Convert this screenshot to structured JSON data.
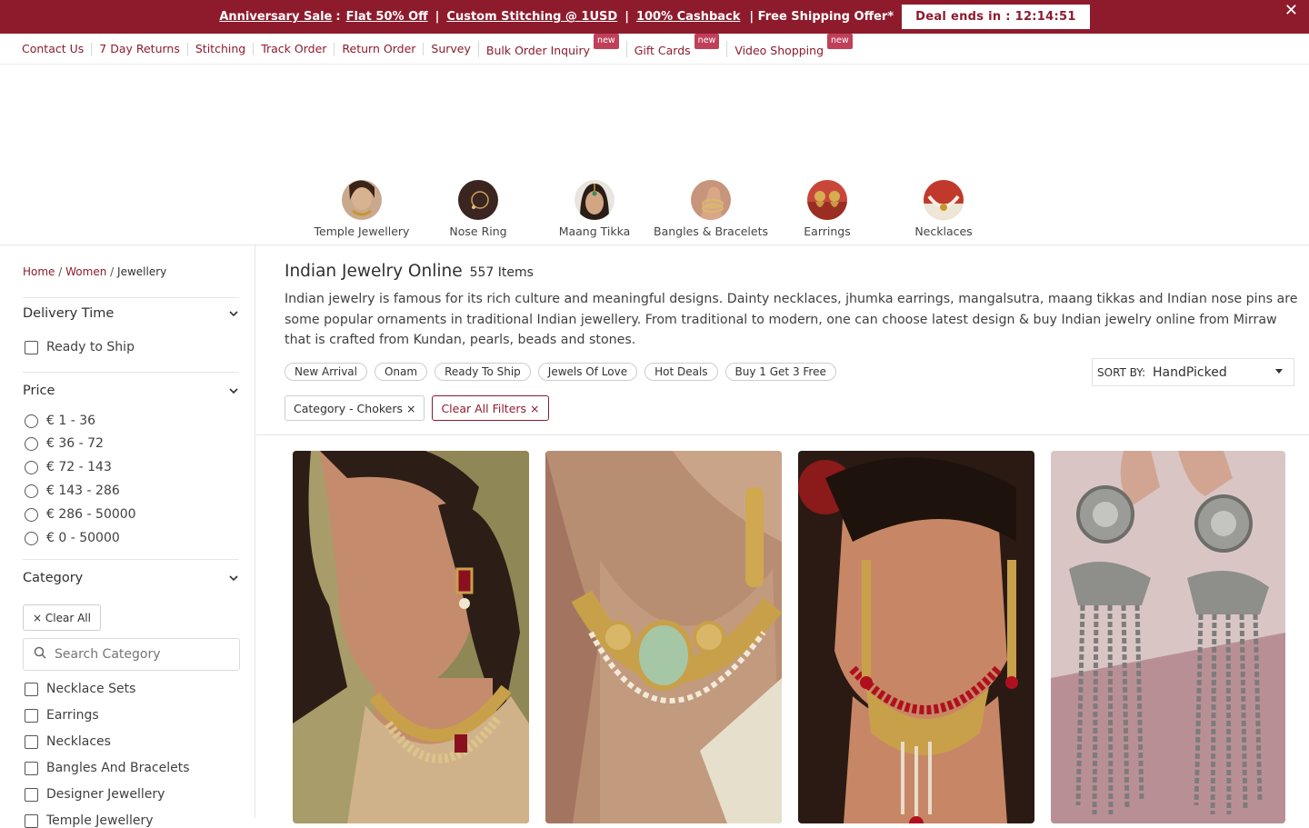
{
  "promo": {
    "items": [
      "Anniversary Sale",
      "Flat 50% Off",
      "Custom Stitching @ 1USD",
      "100% Cashback"
    ],
    "colon": ":",
    "sep": "|",
    "plain": "| Free Shipping Offer*",
    "deal_label": "Deal ends in : ",
    "deal_time": "12:14:51",
    "close": "✕"
  },
  "toplinks": [
    {
      "label": "Contact Us"
    },
    {
      "label": "7 Day Returns"
    },
    {
      "label": "Stitching"
    },
    {
      "label": "Track Order"
    },
    {
      "label": "Return Order"
    },
    {
      "label": "Survey"
    },
    {
      "label": "Bulk Order Inquiry",
      "badge": "new"
    },
    {
      "label": "Gift Cards",
      "badge": "new"
    },
    {
      "label": "Video Shopping",
      "badge": "new"
    }
  ],
  "categories": [
    "Temple Jewellery",
    "Nose Ring",
    "Maang Tikka",
    "Bangles & Bracelets",
    "Earrings",
    "Necklaces"
  ],
  "breadcrumb": {
    "home": "Home",
    "sep": "/",
    "women": "Women",
    "current": "Jewellery"
  },
  "filters": {
    "delivery": {
      "title": "Delivery Time",
      "options": [
        "Ready to Ship"
      ]
    },
    "price": {
      "title": "Price",
      "options": [
        "€ 1 - 36",
        "€ 36 - 72",
        "€ 72 - 143",
        "€ 143 - 286",
        "€ 286 - 50000",
        "€ 0 - 50000"
      ]
    },
    "category": {
      "title": "Category",
      "clear_all": "× Clear All",
      "search_placeholder": "Search Category",
      "options": [
        "Necklace Sets",
        "Earrings",
        "Necklaces",
        "Bangles And Bracelets",
        "Designer Jewellery",
        "Temple Jewellery"
      ]
    },
    "chevron": "⌄"
  },
  "main": {
    "title": "Indian Jewelry Online",
    "count": "557 Items",
    "description": "Indian jewelry is famous for its rich culture and meaningful designs. Dainty necklaces, jhumka earrings, mangalsutra, maang tikkas and Indian nose pins are some popular ornaments in traditional Indian jewellery. From traditional to modern, one can choose latest design & buy Indian jewelry online from Mirraw that is crafted from Kundan, pearls, beads and stones.",
    "chips": [
      "New Arrival",
      "Onam",
      "Ready To Ship",
      "Jewels Of Love",
      "Hot Deals",
      "Buy 1 Get 3 Free"
    ],
    "sort_label": "SORT BY:",
    "sort_value": "HandPicked",
    "applied": [
      "Category - Chokers ×",
      "Clear All Filters ×"
    ]
  },
  "colors": {
    "brand": "#8e1b2c"
  }
}
